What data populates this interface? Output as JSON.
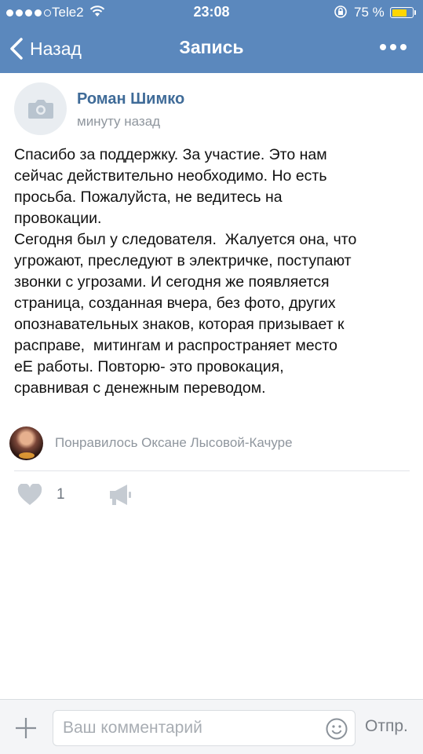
{
  "status_bar": {
    "carrier": "Tele2",
    "time": "23:08",
    "battery": "75 %",
    "battery_level": 0.75,
    "signal_bars": 4
  },
  "nav": {
    "back_label": "Назад",
    "title": "Запись"
  },
  "post": {
    "author": "Роман Шимко",
    "time": "минуту назад",
    "text": "Спасибо за поддержку. За участие. Это нам\nсейчас действительно необходимо. Но есть\nпросьба. Пожалуйста, не ведитесь на\nпровокации.\nСегодня был у следователя.  Жалуется она, что\nугрожают, преследуют в электричке, поступают\nзвонки с угрозами. И сегодня же появляется\nстраница, созданная вчера, без фото, других\nопознавательных знаков, которая призывает к\nрасправе,  митингам и распространяет место\nеЕ работы. Повторю- это провокация,\nсравнивая с денежным переводом.",
    "liked_by": "Понравилось Оксане Лысовой-Качуре",
    "like_count": "1"
  },
  "comment": {
    "placeholder": "Ваш комментарий",
    "send_label": "Отпр."
  },
  "colors": {
    "header": "#5b88bd",
    "author_name": "#3f6b98",
    "muted": "#8f969e",
    "battery": "#ffd600"
  }
}
